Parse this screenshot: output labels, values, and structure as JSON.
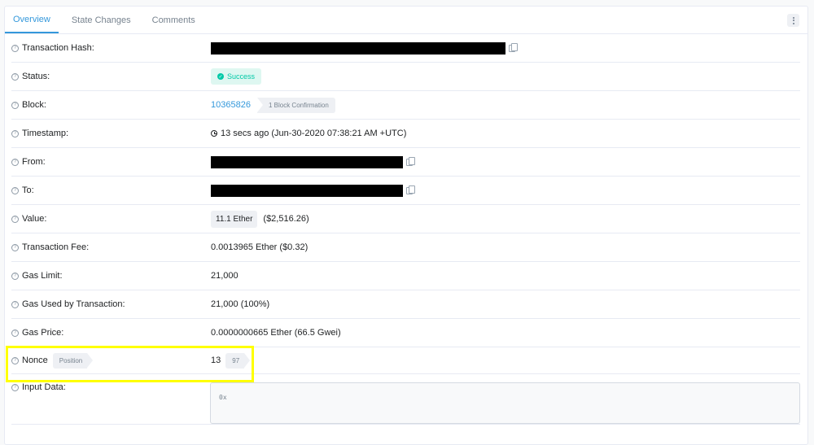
{
  "tabs": [
    {
      "label": "Overview",
      "active": true
    },
    {
      "label": "State Changes",
      "active": false
    },
    {
      "label": "Comments",
      "active": false
    }
  ],
  "menu_icon": "more-vertical-icon",
  "rows": {
    "tx_hash": {
      "label": "Transaction Hash:"
    },
    "status": {
      "label": "Status:",
      "value": "Success"
    },
    "block": {
      "label": "Block:",
      "number": "10365826",
      "confirmations": "1 Block Confirmation"
    },
    "timestamp": {
      "label": "Timestamp:",
      "value": "13 secs ago (Jun-30-2020 07:38:21 AM +UTC)"
    },
    "from": {
      "label": "From:"
    },
    "to": {
      "label": "To:"
    },
    "value": {
      "label": "Value:",
      "amount": "11.1 Ether",
      "usd": "($2,516.26)"
    },
    "fee": {
      "label": "Transaction Fee:",
      "value": "0.0013965 Ether ($0.32)"
    },
    "gas_limit": {
      "label": "Gas Limit:",
      "value": "21,000"
    },
    "gas_used": {
      "label": "Gas Used by Transaction:",
      "value": "21,000 (100%)"
    },
    "gas_price": {
      "label": "Gas Price:",
      "value": "0.0000000665 Ether (66.5 Gwei)"
    },
    "nonce": {
      "label": "Nonce",
      "position_label": "Position",
      "value": "13",
      "position": "97"
    },
    "input": {
      "label": "Input Data:",
      "value": "0x"
    }
  },
  "help_icon_glyph": "?",
  "colors": {
    "accent": "#3498db",
    "success": "#00c9a7",
    "highlight": "#ffff00"
  }
}
